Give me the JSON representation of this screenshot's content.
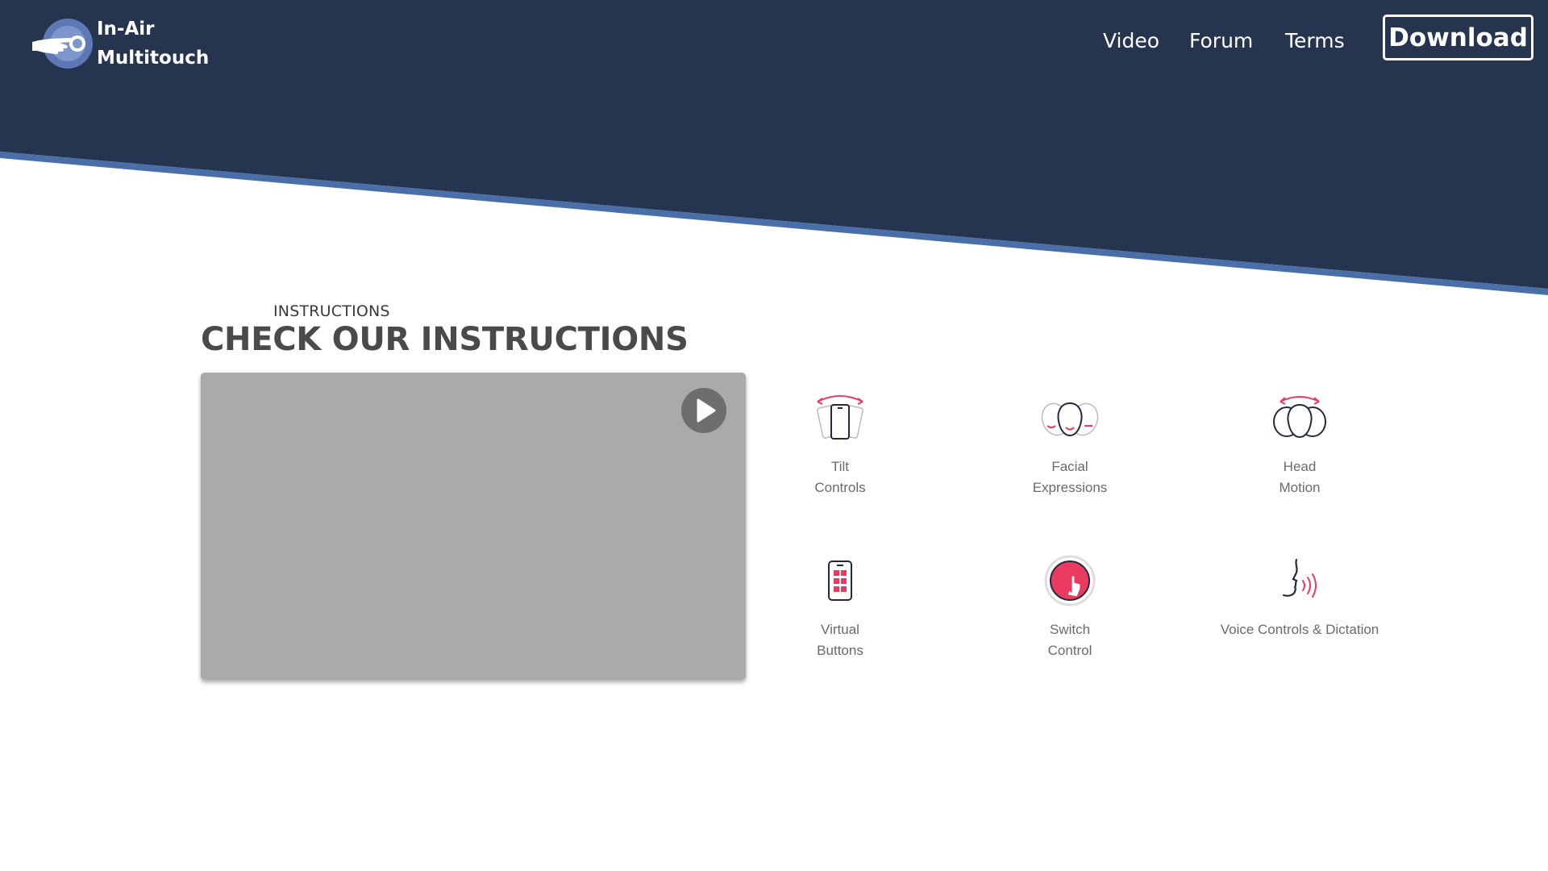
{
  "colors": {
    "header_bg": "#25344f",
    "header_stripe": "#4a6ea8",
    "accent": "#ea3a5f",
    "text_dark": "#4a4a4a",
    "video_bg": "#aaaaaa"
  },
  "header": {
    "logo": {
      "line1": "In-Air",
      "line2": "Multitouch",
      "icon": "hand-pointer-icon"
    },
    "nav": [
      {
        "label": "Video"
      },
      {
        "label": "Forum"
      },
      {
        "label": "Terms"
      }
    ],
    "download_label": "Download"
  },
  "section": {
    "eyebrow": "INSTRUCTIONS",
    "title": "CHECK OUR INSTRUCTIONS"
  },
  "video": {
    "play_icon": "play-icon"
  },
  "features": [
    {
      "icon": "tilt-phone-icon",
      "line1": "Tilt",
      "line2": "Controls"
    },
    {
      "icon": "facial-expression-icon",
      "line1": "Facial",
      "line2": "Expressions"
    },
    {
      "icon": "head-motion-icon",
      "line1": "Head",
      "line2": "Motion"
    },
    {
      "icon": "virtual-buttons-icon",
      "line1": "Virtual",
      "line2": "Buttons"
    },
    {
      "icon": "switch-control-icon",
      "line1": "Switch",
      "line2": "Control"
    },
    {
      "icon": "voice-dictation-icon",
      "line1": "Voice Controls & Dictation",
      "line2": ""
    }
  ]
}
